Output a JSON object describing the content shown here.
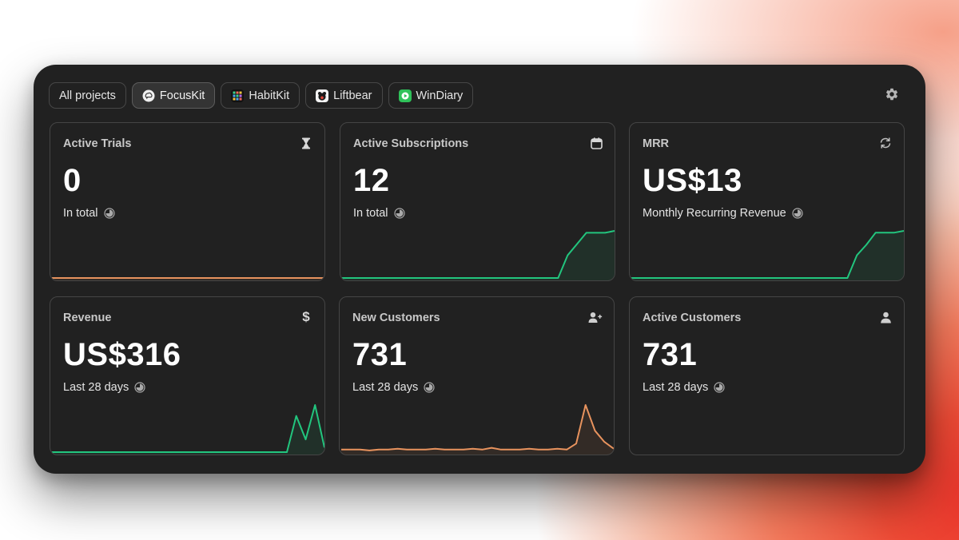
{
  "projects": [
    {
      "label": "All projects",
      "icon": "",
      "selected": false
    },
    {
      "label": "FocusKit",
      "icon": "brain-icon",
      "selected": true
    },
    {
      "label": "HabitKit",
      "icon": "habitkit-app-icon",
      "selected": false
    },
    {
      "label": "Liftbear",
      "icon": "liftbear-app-icon",
      "selected": false
    },
    {
      "label": "WinDiary",
      "icon": "windiary-app-icon",
      "selected": false
    }
  ],
  "settings_icon": "gear-icon",
  "colors": {
    "green": "#22c57e",
    "orange": "#e8935e",
    "window_bg": "#212121",
    "card_border": "#454545"
  },
  "cards": [
    {
      "title": "Active Trials",
      "value": "0",
      "subtitle": "In total",
      "icon": "hourglass-icon",
      "trend": {
        "color": "orange",
        "points": [
          0,
          0,
          0,
          0,
          0,
          0,
          0,
          0,
          0,
          0,
          0,
          0,
          0,
          0,
          0,
          0,
          0,
          0,
          0,
          0,
          0,
          0,
          0,
          0,
          0,
          0,
          0,
          0,
          0,
          0
        ]
      }
    },
    {
      "title": "Active Subscriptions",
      "value": "12",
      "subtitle": "In total",
      "icon": "calendar-icon",
      "trend": {
        "color": "green",
        "points": [
          0,
          0,
          0,
          0,
          0,
          0,
          0,
          0,
          0,
          0,
          0,
          0,
          0,
          0,
          0,
          0,
          0,
          0,
          0,
          0,
          0,
          0,
          0,
          0,
          6,
          9,
          12,
          12,
          12,
          12.5
        ]
      }
    },
    {
      "title": "MRR",
      "value": "US$13",
      "subtitle": "Monthly Recurring Revenue",
      "icon": "refresh-icon",
      "trend": {
        "color": "green",
        "points": [
          0,
          0,
          0,
          0,
          0,
          0,
          0,
          0,
          0,
          0,
          0,
          0,
          0,
          0,
          0,
          0,
          0,
          0,
          0,
          0,
          0,
          0,
          0,
          0,
          6.5,
          9.5,
          13,
          13,
          13,
          13.5
        ]
      }
    },
    {
      "title": "Revenue",
      "value": "US$316",
      "subtitle": "Last 28 days",
      "icon": "dollar-icon",
      "trend": {
        "color": "green",
        "points": [
          0,
          0,
          0,
          0,
          0,
          0,
          0,
          0,
          0,
          0,
          0,
          0,
          0,
          0,
          0,
          0,
          0,
          0,
          0,
          0,
          0,
          0,
          0,
          0,
          0,
          0,
          40,
          14,
          52,
          5
        ]
      }
    },
    {
      "title": "New Customers",
      "value": "731",
      "subtitle": "Last 28 days",
      "icon": "add-user-icon",
      "trend": {
        "color": "orange",
        "points": [
          3,
          3,
          3,
          2,
          3,
          3,
          4,
          3,
          3,
          3,
          4,
          3,
          3,
          3,
          4,
          3,
          5,
          3,
          3,
          3,
          4,
          3,
          3,
          4,
          3,
          10,
          55,
          25,
          12,
          4
        ]
      }
    },
    {
      "title": "Active Customers",
      "value": "731",
      "subtitle": "Last 28 days",
      "icon": "user-icon",
      "trend": null
    }
  ]
}
